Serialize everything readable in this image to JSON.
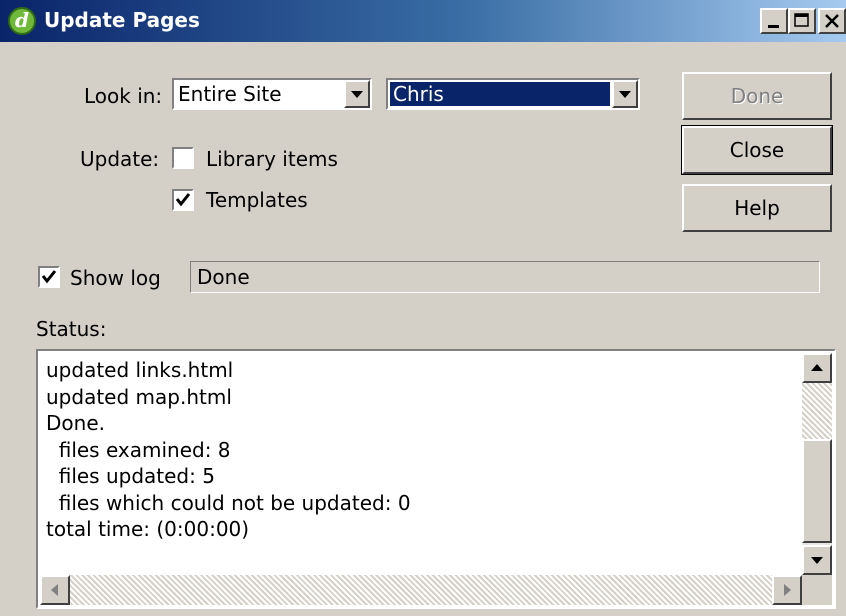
{
  "window": {
    "title": "Update Pages"
  },
  "look_in": {
    "label": "Look in:",
    "scope_value": "Entire Site",
    "site_value": "Chris"
  },
  "update": {
    "label": "Update:",
    "library_items": {
      "label": "Library items",
      "checked": false
    },
    "templates": {
      "label": "Templates",
      "checked": true
    }
  },
  "buttons": {
    "done": "Done",
    "close": "Close",
    "help": "Help"
  },
  "show_log": {
    "label": "Show log",
    "checked": true,
    "status_field": "Done"
  },
  "status": {
    "label": "Status:",
    "lines": [
      "updated links.html",
      "updated map.html",
      "Done.",
      "  files examined: 8",
      "  files updated: 5",
      "  files which could not be updated: 0",
      "total time: (0:00:00)"
    ]
  }
}
